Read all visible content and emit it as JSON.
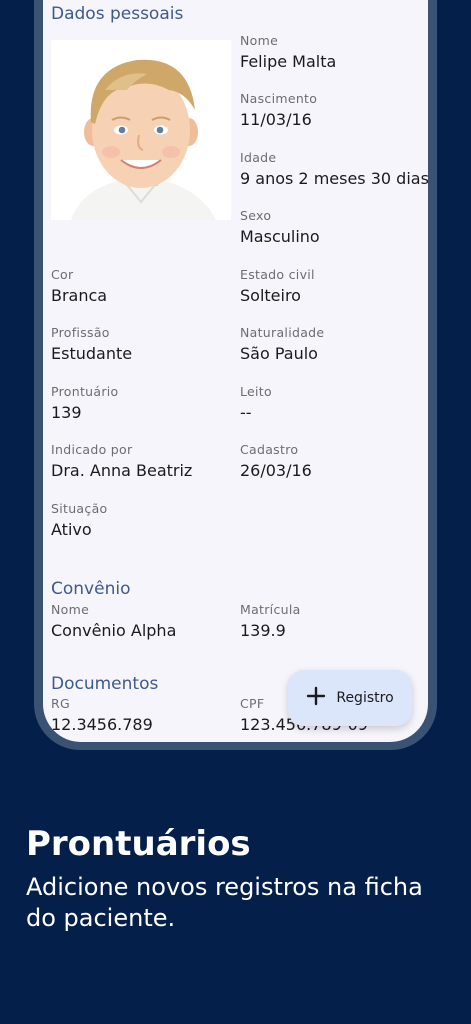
{
  "personal": {
    "section_title": "Dados pessoais",
    "photo_alt": "Foto do paciente",
    "nome_label": "Nome",
    "nome": "Felipe Malta",
    "nascimento_label": "Nascimento",
    "nascimento": "11/03/16",
    "idade_label": "Idade",
    "idade": "9 anos 2 meses 30 dias",
    "sexo_label": "Sexo",
    "sexo": "Masculino",
    "cor_label": "Cor",
    "cor": "Branca",
    "estado_civil_label": "Estado civil",
    "estado_civil": "Solteiro",
    "profissao_label": "Profissão",
    "profissao": "Estudante",
    "naturalidade_label": "Naturalidade",
    "naturalidade": "São Paulo",
    "prontuario_label": "Prontuário",
    "prontuario": "139",
    "leito_label": "Leito",
    "leito": "--",
    "indicado_label": "Indicado por",
    "indicado": "Dra. Anna Beatriz",
    "cadastro_label": "Cadastro",
    "cadastro": "26/03/16",
    "situacao_label": "Situação",
    "situacao": "Ativo"
  },
  "convenio": {
    "section_title": "Convênio",
    "nome_label": "Nome",
    "nome": "Convênio Alpha",
    "matricula_label": "Matrícula",
    "matricula": "139.9"
  },
  "documentos": {
    "section_title": "Documentos",
    "rg_label": "RG",
    "rg": "12.3456.789",
    "cpf_label": "CPF",
    "cpf": "123.456.789-09"
  },
  "fab": {
    "icon": "plus-icon",
    "label": "Registro"
  },
  "promo": {
    "title": "Prontuários",
    "subtitle": "Adicione novos registros na ficha do paciente."
  }
}
